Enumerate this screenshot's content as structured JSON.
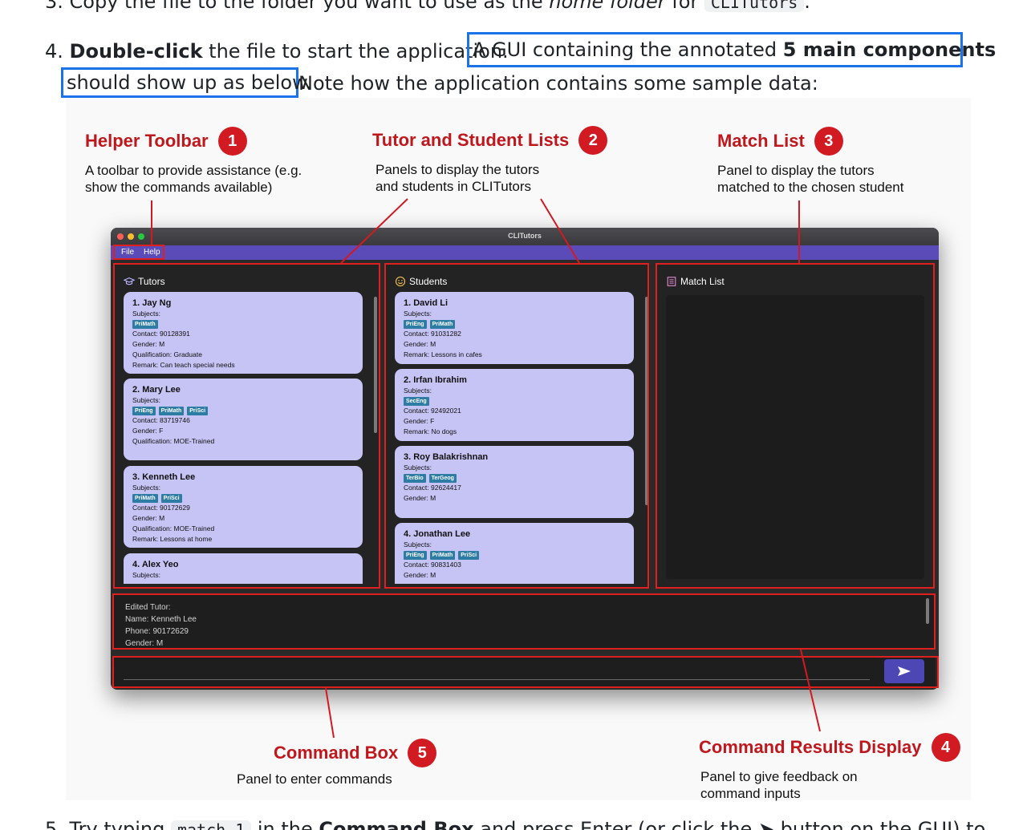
{
  "doc": {
    "step3_prefix": "3. Copy the file to the folder you want to use as the ",
    "step3_italic": "home folder",
    "step3_mid": " for ",
    "step3_code": "CLITutors",
    "step3_suffix": ".",
    "step4_num": "4. ",
    "step4_bold": "Double-click",
    "step4_text": " the file to start the application.",
    "step4_box1_a": "A GUI containing the annotated ",
    "step4_box1_bold": "5 main components",
    "step4_box2": "should show up as below.",
    "step4_tail": " Note how the application contains some sample data:",
    "step5_prefix": "5. Try typing ",
    "step5_code": "match 1",
    "step5_mid": " in the ",
    "step5_bold": "Command Box",
    "step5_suffix": " and press Enter (or click the ➤ button on the GUI) to"
  },
  "callouts": {
    "toolbar": {
      "title": "Helper Toolbar",
      "num": "1",
      "desc": "A toolbar to provide assistance (e.g.\nshow the commands available)"
    },
    "lists": {
      "title": "Tutor and Student Lists",
      "num": "2",
      "desc": "Panels to display the tutors\nand students in CLITutors"
    },
    "match": {
      "title": "Match List",
      "num": "3",
      "desc": "Panel to display the tutors\nmatched to the chosen student"
    },
    "results": {
      "title": "Command Results Display",
      "num": "4",
      "desc": "Panel to give feedback on\ncommand  inputs"
    },
    "command": {
      "title": "Command Box",
      "num": "5",
      "desc": "Panel to enter commands"
    }
  },
  "app": {
    "window_title": "CLITutors",
    "menu": [
      "File",
      "Help"
    ],
    "tutors_header": "Tutors",
    "students_header": "Students",
    "match_header": "Match List",
    "tutors": [
      {
        "name": "1.  Jay Ng",
        "subjects_label": "Subjects:",
        "tags": [
          "PriMath"
        ],
        "lines": [
          "Contact: 90128391",
          "Gender: M",
          "Qualification: Graduate",
          "Remark: Can teach special needs"
        ]
      },
      {
        "name": "2.  Mary Lee",
        "subjects_label": "Subjects:",
        "tags": [
          "PriEng",
          "PriMath",
          "PriSci"
        ],
        "lines": [
          "Contact: 83719746",
          "Gender: F",
          "Qualification: MOE-Trained"
        ]
      },
      {
        "name": "3.  Kenneth Lee",
        "subjects_label": "Subjects:",
        "tags": [
          "PriMath",
          "PriSci"
        ],
        "lines": [
          "Contact: 90172629",
          "Gender: M",
          "Qualification: MOE-Trained",
          "Remark: Lessons at home"
        ]
      },
      {
        "name": "4.  Alex Yeo",
        "subjects_label": "Subjects:",
        "tags": [],
        "lines": []
      }
    ],
    "students": [
      {
        "name": "1.  David Li",
        "subjects_label": "Subjects:",
        "tags": [
          "PriEng",
          "PriMath"
        ],
        "lines": [
          "Contact: 91031282",
          "Gender: M",
          "Remark: Lessons in cafes"
        ]
      },
      {
        "name": "2.  Irfan Ibrahim",
        "subjects_label": "Subjects:",
        "tags": [
          "SecEng"
        ],
        "lines": [
          "Contact: 92492021",
          "Gender: F",
          "Remark: No dogs"
        ]
      },
      {
        "name": "3.  Roy Balakrishnan",
        "subjects_label": "Subjects:",
        "tags": [
          "TerBio",
          "TerGeog"
        ],
        "lines": [
          "Contact: 92624417",
          "Gender: M"
        ]
      },
      {
        "name": "4.  Jonathan Lee",
        "subjects_label": "Subjects:",
        "tags": [
          "PriEng",
          "PriMath",
          "PriSci"
        ],
        "lines": [
          "Contact: 90831403",
          "Gender: M"
        ]
      }
    ],
    "result_text": "Edited Tutor:\nName: Kenneth Lee\nPhone: 90172629\nGender: M",
    "command_value": ""
  },
  "colors": {
    "accent_blue": "#1a73e8",
    "annotation_red": "#d21a22",
    "menubar": "#5a4bb8",
    "card": "#c5c4f4",
    "tag": "#2c7ca4"
  }
}
